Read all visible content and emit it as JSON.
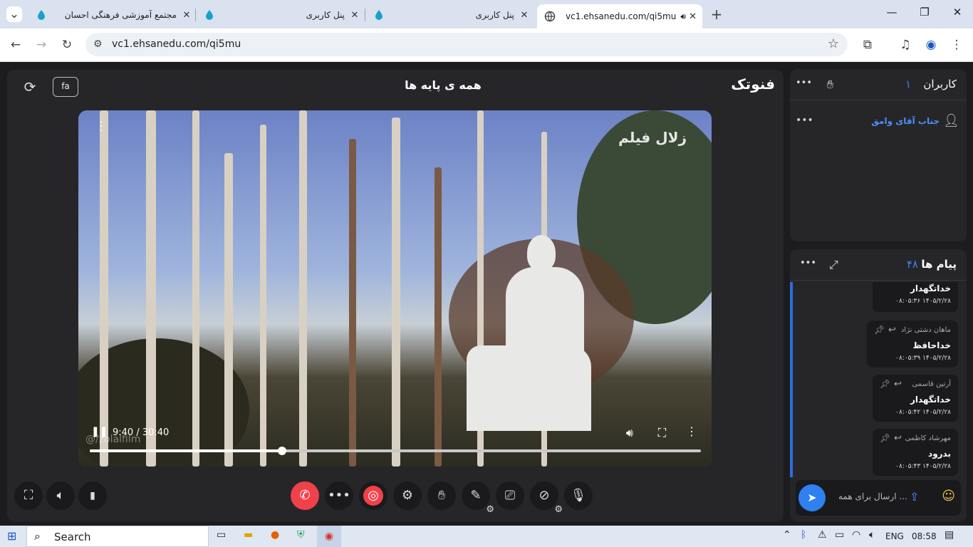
{
  "browser": {
    "tabs": [
      {
        "title": "مجتمع آموزشی فرهنگی احسان",
        "active": false
      },
      {
        "title": "پنل کاربری",
        "active": false
      },
      {
        "title": "پنل کاربری",
        "active": false
      },
      {
        "title": "vc1.ehsanedu.com/qi5mu",
        "active": true
      }
    ],
    "url": "vc1.ehsanedu.com/qi5mu",
    "new_tab": "+",
    "close_glyph": "✕",
    "window": {
      "min": "—",
      "max": "❐",
      "close": "✕"
    }
  },
  "room": {
    "brand": "فنوتک",
    "title": "همه ی پایه ها",
    "lang": "fa"
  },
  "video": {
    "current_time": "9:40 / 30:40",
    "progress": 0.315,
    "watermark": "زلال فیلم",
    "handle": "@/zolalfilm"
  },
  "users": {
    "title": "کاربران",
    "count": "۱",
    "items": [
      {
        "name": "جناب آقای وامق"
      }
    ]
  },
  "messages": {
    "title": "پیام ها",
    "count": "۴۸",
    "items": [
      {
        "sender": "",
        "text": "خداتگهدار",
        "time": "۰۸:۰۵:۳۶ ۱۴۰۵/۲/۲۸"
      },
      {
        "sender": "ماهان دشتی نژاد",
        "text": "خداحافظ",
        "time": "۰۸:۰۵:۳۹ ۱۴۰۵/۲/۲۸"
      },
      {
        "sender": "آرتین قاسمی",
        "text": "خداتگهدار",
        "time": "۰۸:۰۵:۴۲ ۱۴۰۵/۲/۲۸"
      },
      {
        "sender": "مهرشاد کاظمی",
        "text": "بدرود",
        "time": "۰۸:۰۵:۴۳ ۱۴۰۵/۲/۲۸"
      }
    ],
    "placeholder": "ارسال برای همه ..."
  },
  "taskbar": {
    "search": "Search",
    "lang": "ENG",
    "clock": "08:58"
  },
  "colors": {
    "accent": "#2f80f0",
    "danger": "#f0414b",
    "panel": "#262629"
  }
}
